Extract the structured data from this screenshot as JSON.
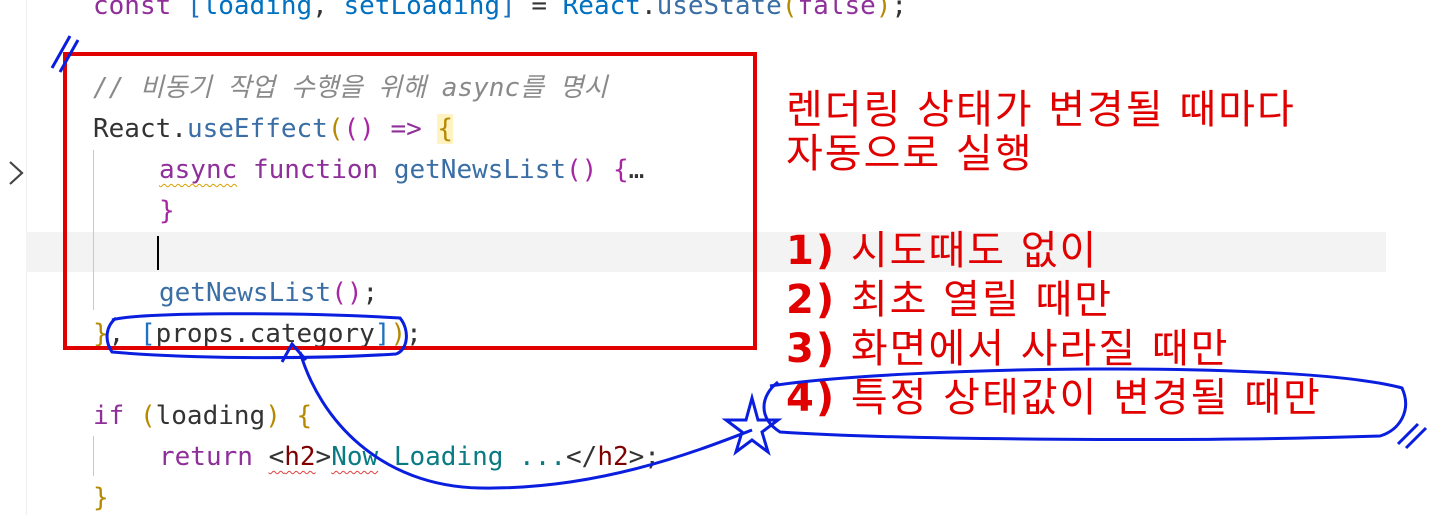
{
  "editor": {
    "lines": [
      {
        "text": "const [loading, setLoading] = React.useState(false);"
      },
      {
        "text": "// 비동기 작업 수행을 위해 async를 명시"
      },
      {
        "text": "React.useEffect(() => {"
      },
      {
        "text": "async function getNewsList() {…"
      },
      {
        "text": "}"
      },
      {
        "text": ""
      },
      {
        "text": "getNewsList();"
      },
      {
        "text": "}, [props.category]);"
      },
      {
        "text": ""
      },
      {
        "text": "if (loading) {"
      },
      {
        "text": "return <h2>Now Loading ...</h2>;"
      },
      {
        "text": "}"
      }
    ]
  },
  "annotations": {
    "title_line1": "렌더링 상태가 변경될 때마다",
    "title_line2": "자동으로 실행",
    "items": [
      {
        "num": "1)",
        "text": "시도때도 없이"
      },
      {
        "num": "2)",
        "text": "최초 열릴 때만"
      },
      {
        "num": "3)",
        "text": "화면에서 사라질 때만"
      },
      {
        "num": "4)",
        "text": "특정 상태값이 변경될 때만"
      }
    ],
    "colors": {
      "red": "#e00000",
      "blue": "#0a1ee0"
    }
  }
}
